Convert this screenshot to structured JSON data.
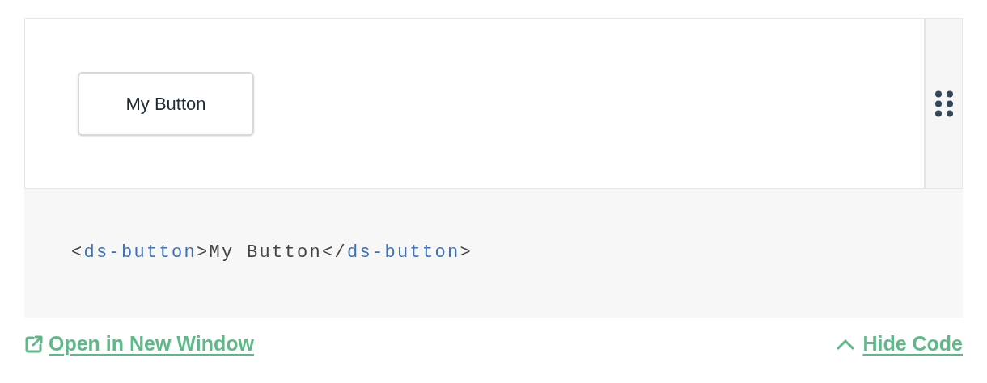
{
  "preview": {
    "button_label": "My Button"
  },
  "code": [
    {
      "kind": "punct",
      "text": "<"
    },
    {
      "kind": "tag",
      "text": "ds-button"
    },
    {
      "kind": "punct",
      "text": ">My Button</"
    },
    {
      "kind": "tag",
      "text": "ds-button"
    },
    {
      "kind": "punct",
      "text": ">"
    }
  ],
  "footer": {
    "open_link": "Open in New Window",
    "toggle_link": "Hide Code"
  }
}
